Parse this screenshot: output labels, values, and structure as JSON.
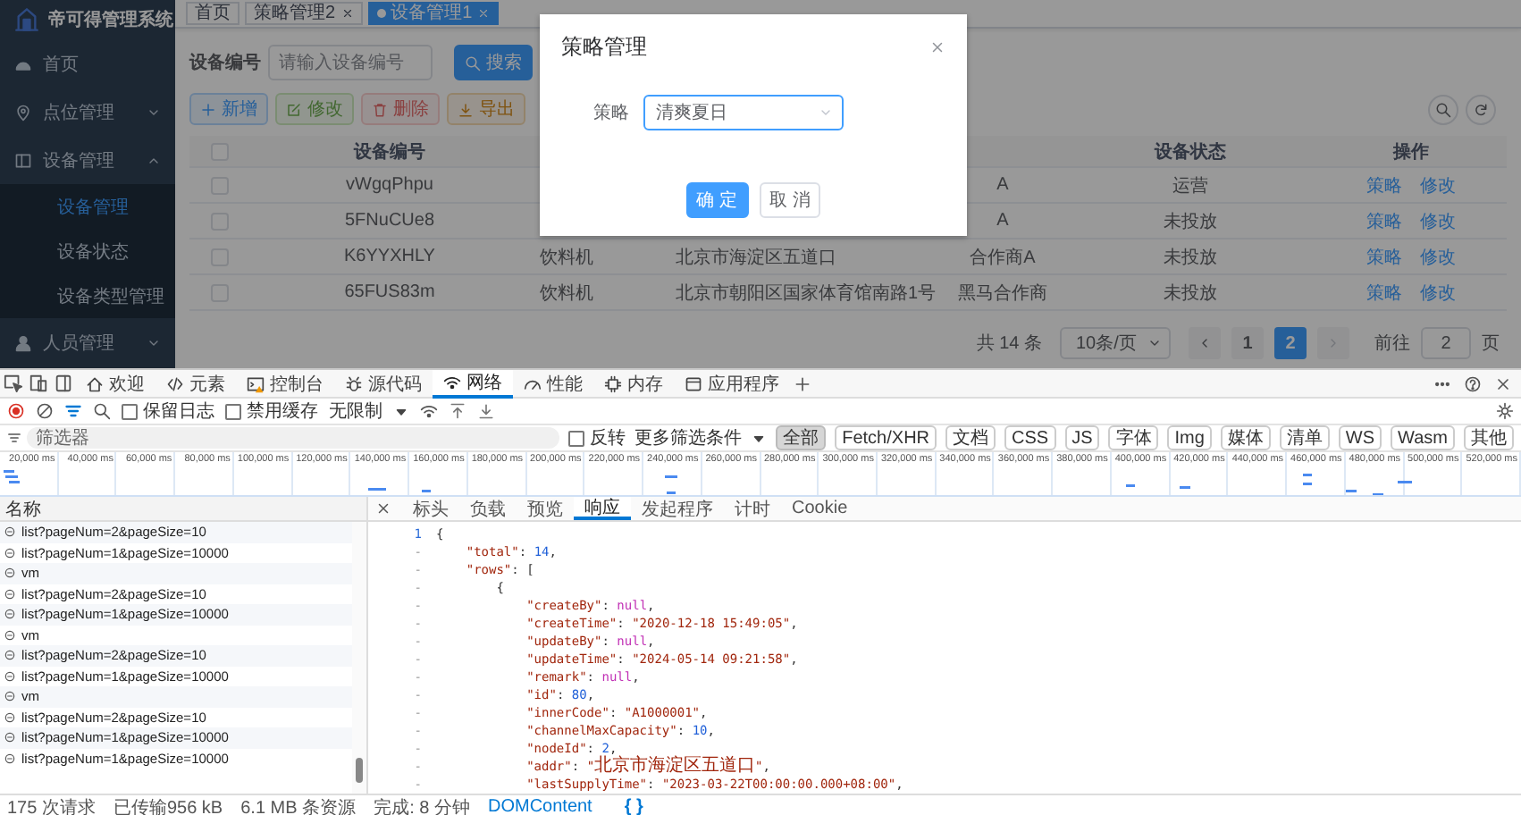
{
  "app": {
    "logo_title": "帝可得管理系统",
    "sidebar": [
      {
        "label": "首页"
      },
      {
        "label": "点位管理",
        "expanded": false
      },
      {
        "label": "设备管理",
        "expanded": true,
        "children": [
          {
            "label": "设备管理",
            "selected": true
          },
          {
            "label": "设备状态",
            "selected": false
          },
          {
            "label": "设备类型管理",
            "selected": false
          }
        ]
      },
      {
        "label": "人员管理",
        "expanded": false
      }
    ],
    "tags": [
      {
        "label": "首页",
        "selected": false,
        "closable": false
      },
      {
        "label": "策略管理2",
        "selected": false,
        "closable": true
      },
      {
        "label": "设备管理1",
        "selected": true,
        "closable": true
      }
    ],
    "search": {
      "label": "设备编号",
      "placeholder": "请输入设备编号",
      "button": "搜索"
    },
    "actions": [
      {
        "label": "新增",
        "kind": "primary",
        "disabled": false
      },
      {
        "label": "修改",
        "kind": "success",
        "disabled": true
      },
      {
        "label": "删除",
        "kind": "danger",
        "disabled": true
      },
      {
        "label": "导出",
        "kind": "warning",
        "disabled": false
      }
    ],
    "table": {
      "select_all": false,
      "header": {
        "code": "设备编号",
        "status": "设备状态",
        "actions": "操作"
      },
      "rows": [
        {
          "checked": false,
          "code": "vWgqPhpu",
          "partner": "A",
          "status": "运营",
          "actions": [
            "策略",
            "修改"
          ]
        },
        {
          "checked": false,
          "code": "5FNuCUe8",
          "partner": "A",
          "status": "未投放",
          "actions": [
            "策略",
            "修改"
          ]
        },
        {
          "checked": false,
          "code": "K6YYXHLY",
          "type": "饮料机",
          "address": "北京市海淀区五道口",
          "partner": "合作商A",
          "status": "未投放",
          "actions": [
            "策略",
            "修改"
          ]
        },
        {
          "checked": false,
          "code": "65FUS83m",
          "type": "饮料机",
          "address": "北京市朝阳区国家体育馆南路1号",
          "partner": "黑马合作商",
          "status": "未投放",
          "actions": [
            "策略",
            "修改"
          ]
        }
      ]
    },
    "pagination": {
      "total": "共 14 条",
      "page_size": "10条/页",
      "pages": [
        {
          "label": "1",
          "selected": false
        },
        {
          "label": "2",
          "selected": true
        }
      ],
      "goto_label": "前往",
      "goto_value": "2",
      "goto_suffix": "页"
    },
    "dialog": {
      "title": "策略管理",
      "field_label": "策略",
      "value": "清爽夏日",
      "buttons": [
        {
          "label": "确 定",
          "kind": "primary"
        },
        {
          "label": "取 消",
          "kind": "default"
        }
      ]
    }
  },
  "devtools": {
    "tabs": [
      {
        "label": "欢迎",
        "selected": false,
        "warning": false
      },
      {
        "label": "元素",
        "selected": false,
        "warning": false
      },
      {
        "label": "控制台",
        "selected": false,
        "warning": true
      },
      {
        "label": "源代码",
        "selected": false,
        "warning": false
      },
      {
        "label": "网络",
        "selected": true,
        "warning": false
      },
      {
        "label": "性能",
        "selected": false,
        "warning": false
      },
      {
        "label": "内存",
        "selected": false,
        "warning": false
      },
      {
        "label": "应用程序",
        "selected": false,
        "warning": false
      }
    ],
    "toolbar": {
      "recording": true,
      "options": [
        {
          "label": "保留日志",
          "checked": false
        },
        {
          "label": "禁用缓存",
          "checked": false
        }
      ],
      "throttling": "无限制"
    },
    "filter": {
      "placeholder": "筛选器",
      "invert": {
        "label": "反转",
        "checked": false
      },
      "more_filters": "更多筛选条件",
      "types": [
        {
          "label": "全部",
          "selected": true
        },
        {
          "label": "Fetch/XHR",
          "selected": false
        },
        {
          "label": "文档",
          "selected": false
        },
        {
          "label": "CSS",
          "selected": false
        },
        {
          "label": "JS",
          "selected": false
        },
        {
          "label": "字体",
          "selected": false
        },
        {
          "label": "Img",
          "selected": false
        },
        {
          "label": "媒体",
          "selected": false
        },
        {
          "label": "清单",
          "selected": false
        },
        {
          "label": "WS",
          "selected": false
        },
        {
          "label": "Wasm",
          "selected": false
        },
        {
          "label": "其他",
          "selected": false
        }
      ]
    },
    "timeline_ticks": [
      "20,000 ms",
      "40,000 ms",
      "60,000 ms",
      "80,000 ms",
      "100,000 ms",
      "120,000 ms",
      "140,000 ms",
      "160,000 ms",
      "180,000 ms",
      "200,000 ms",
      "220,000 ms",
      "240,000 ms",
      "260,000 ms",
      "280,000 ms",
      "300,000 ms",
      "320,000 ms",
      "340,000 ms",
      "360,000 ms",
      "380,000 ms",
      "400,000 ms",
      "420,000 ms",
      "440,000 ms",
      "460,000 ms",
      "480,000 ms",
      "500,000 ms",
      "520,000 ms"
    ],
    "requests": {
      "header": "名称",
      "rows": [
        {
          "name": "list?pageNum=2&pageSize=10"
        },
        {
          "name": "list?pageNum=1&pageSize=10000"
        },
        {
          "name": "vm"
        },
        {
          "name": "list?pageNum=2&pageSize=10"
        },
        {
          "name": "list?pageNum=1&pageSize=10000"
        },
        {
          "name": "vm"
        },
        {
          "name": "list?pageNum=2&pageSize=10"
        },
        {
          "name": "list?pageNum=1&pageSize=10000"
        },
        {
          "name": "vm"
        },
        {
          "name": "list?pageNum=2&pageSize=10"
        },
        {
          "name": "list?pageNum=1&pageSize=10000"
        },
        {
          "name": "list?pageNum=1&pageSize=10000"
        }
      ]
    },
    "detail": {
      "tabs": [
        {
          "label": "标头",
          "selected": false
        },
        {
          "label": "负载",
          "selected": false
        },
        {
          "label": "预览",
          "selected": false
        },
        {
          "label": "响应",
          "selected": true
        },
        {
          "label": "发起程序",
          "selected": false
        },
        {
          "label": "计时",
          "selected": false
        },
        {
          "label": "Cookie",
          "selected": false
        }
      ],
      "lines": [
        {
          "marker": "1",
          "text": "{"
        },
        {
          "marker": "-",
          "text": "    \"total\": 14,"
        },
        {
          "marker": "-",
          "text": "    \"rows\": ["
        },
        {
          "marker": "-",
          "text": "        {"
        },
        {
          "marker": "-",
          "text": "            \"createBy\": null,"
        },
        {
          "marker": "-",
          "text": "            \"createTime\": \"2020-12-18 15:49:05\","
        },
        {
          "marker": "-",
          "text": "            \"updateBy\": null,"
        },
        {
          "marker": "-",
          "text": "            \"updateTime\": \"2024-05-14 09:21:58\","
        },
        {
          "marker": "-",
          "text": "            \"remark\": null,"
        },
        {
          "marker": "-",
          "text": "            \"id\": 80,"
        },
        {
          "marker": "-",
          "text": "            \"innerCode\": \"A1000001\","
        },
        {
          "marker": "-",
          "text": "            \"channelMaxCapacity\": 10,"
        },
        {
          "marker": "-",
          "text": "            \"nodeId\": 2,"
        },
        {
          "marker": "-",
          "text": "            \"addr\": \"北京市海淀区五道口\","
        },
        {
          "marker": "-",
          "text": "            \"lastSupplyTime\": \"2023-03-22T00:00:00.000+08:00\","
        }
      ]
    },
    "status": [
      "175 次请求",
      "已传输956 kB",
      "6.1 MB 条资源",
      "完成: 8 分钟",
      "DOMContent"
    ],
    "format_button": "{ }"
  }
}
